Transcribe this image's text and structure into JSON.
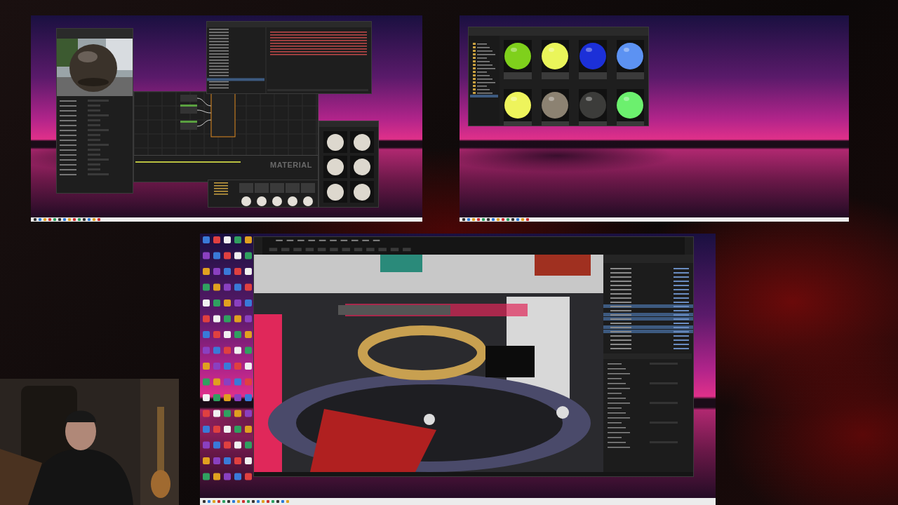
{
  "top_left_desktop": {
    "graph_label": "MATERIAL"
  },
  "top_right_desktop": {
    "materials": [
      {
        "color": "#7fd01c"
      },
      {
        "color": "#eaf55a"
      },
      {
        "color": "#1c30d8"
      },
      {
        "color": "#5c92f2"
      },
      {
        "color": "#eef45c"
      },
      {
        "color": "#8c8272"
      },
      {
        "color": "#3c3c3a"
      },
      {
        "color": "#6cf06e"
      }
    ]
  },
  "bottom_desktop": {
    "outliner_rows": [
      {
        "selected": false
      },
      {
        "selected": false
      },
      {
        "selected": false
      },
      {
        "selected": false
      },
      {
        "selected": false
      },
      {
        "selected": false
      },
      {
        "selected": false
      },
      {
        "selected": false
      },
      {
        "selected": false
      },
      {
        "selected": true
      },
      {
        "selected": false
      },
      {
        "selected": true
      },
      {
        "selected": true
      },
      {
        "selected": false
      },
      {
        "selected": true
      },
      {
        "selected": true
      },
      {
        "selected": false
      },
      {
        "selected": false
      },
      {
        "selected": false
      },
      {
        "selected": false
      }
    ]
  }
}
